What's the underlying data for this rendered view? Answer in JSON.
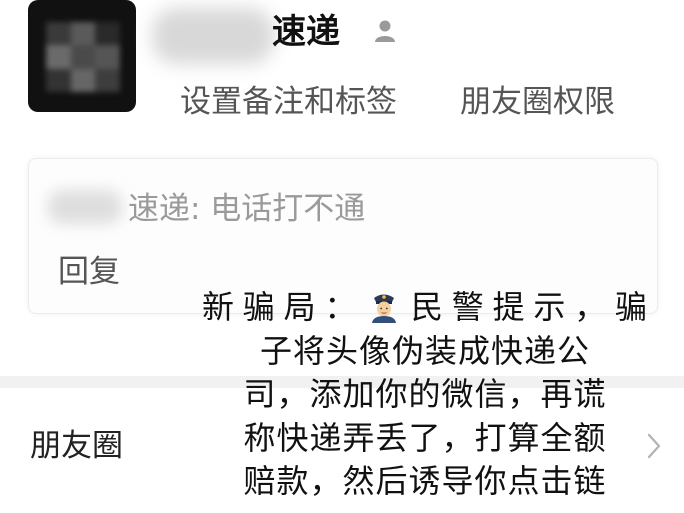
{
  "contact": {
    "name": "速递",
    "actions": {
      "note": "设置备注和标签",
      "moments_permission": "朋友圈权限"
    }
  },
  "message": {
    "text": "速递: 电话打不通",
    "reply": "回复"
  },
  "moments": {
    "label": "朋友圈"
  },
  "overlay": {
    "line1_prefix": "新骗局：",
    "line1_suffix": "民警提示，骗",
    "line2": "子将头像伪装成快递公",
    "line3": "司，添加你的微信，再谎",
    "line4": "称快递弄丢了，打算全额",
    "line5": "赔款，然后诱导你点击链"
  },
  "icons": {
    "person": "person-icon",
    "police": "police-officer-icon",
    "chevron": "chevron-right-icon"
  },
  "colors": {
    "primary_text": "#111111",
    "secondary_text": "#555555",
    "muted_text": "#9a9a9a",
    "divider": "#f1f1f1"
  }
}
